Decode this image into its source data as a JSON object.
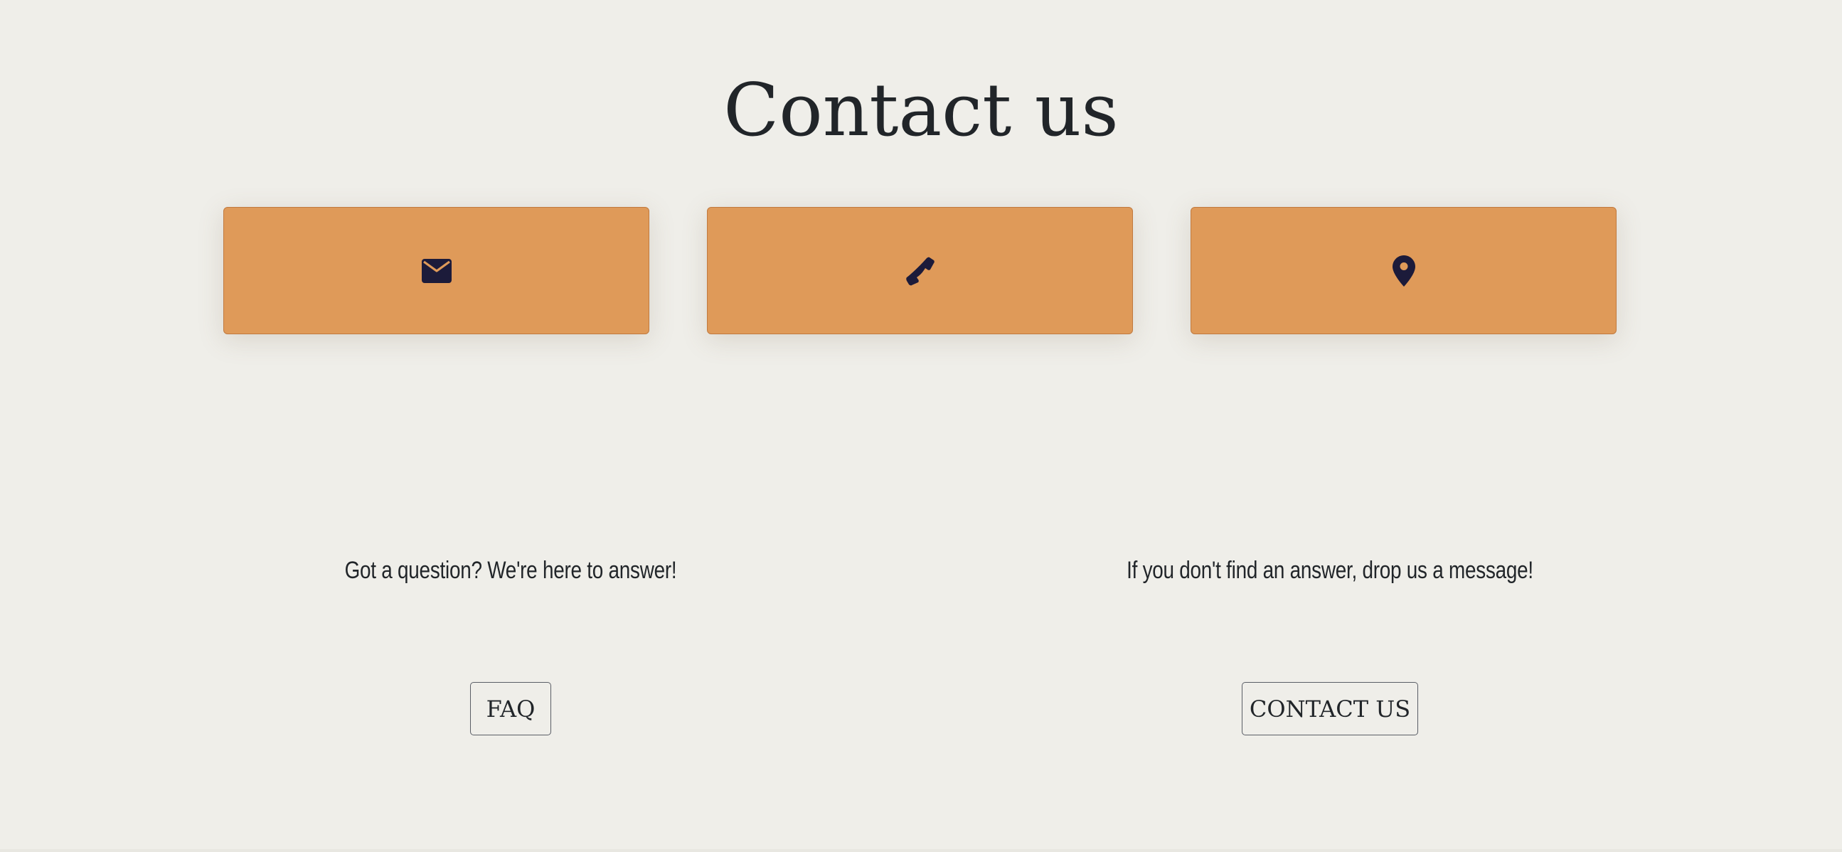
{
  "page": {
    "title": "Contact us"
  },
  "cards": [
    {
      "name": "email",
      "icon": "envelope-icon"
    },
    {
      "name": "phone",
      "icon": "phone-icon"
    },
    {
      "name": "location",
      "icon": "map-marker-icon"
    }
  ],
  "sections": {
    "faq": {
      "text": "Got a question? We're here to answer!",
      "button_label": "FAQ"
    },
    "contact": {
      "text": "If you don't find an answer, drop us a message!",
      "button_label": "CONTACT US"
    }
  },
  "colors": {
    "background": "#efeee9",
    "card": "#df9a59",
    "card_border": "#c17a3f",
    "icon": "#1c1b3a",
    "text": "#212529"
  }
}
